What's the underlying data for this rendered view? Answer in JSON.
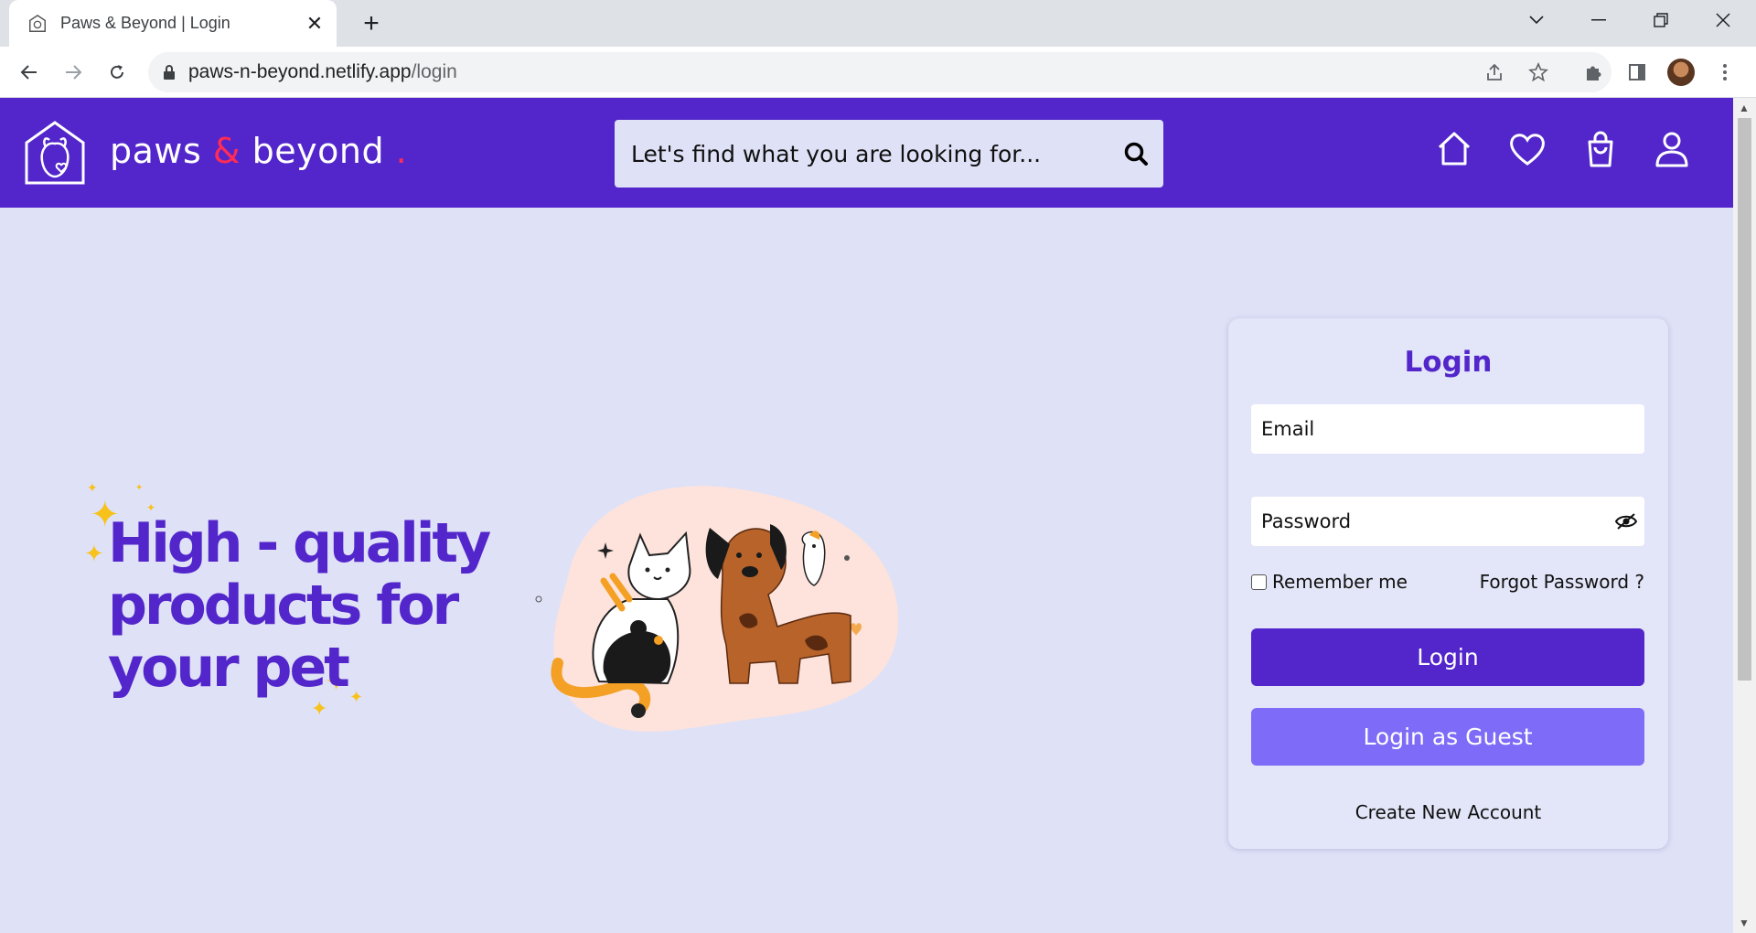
{
  "browser": {
    "tab_title": "Paws & Beyond | Login",
    "url_host": "paws-n-beyond.netlify.app",
    "url_path": "/login"
  },
  "header": {
    "brand_word1": "paws",
    "brand_amp": "&",
    "brand_word2": "beyond",
    "brand_dot": ".",
    "search_placeholder": "Let's find what you are looking for...",
    "nav_icons": [
      "home-icon",
      "heart-icon",
      "shopping-bag-icon",
      "user-icon"
    ]
  },
  "hero": {
    "line1": "High - quality",
    "line2": "products for",
    "line3": "your pet"
  },
  "login_card": {
    "title": "Login",
    "email_placeholder": "Email",
    "password_placeholder": "Password",
    "remember_label": "Remember me",
    "forgot_label": "Forgot Password ?",
    "login_button": "Login",
    "guest_button": "Login as Guest",
    "create_account": "Create New Account"
  },
  "colors": {
    "brand_purple": "#5226cb",
    "guest_purple": "#7e6cf8",
    "page_bg": "#dfe1f7",
    "accent_red": "#ff2c55"
  }
}
